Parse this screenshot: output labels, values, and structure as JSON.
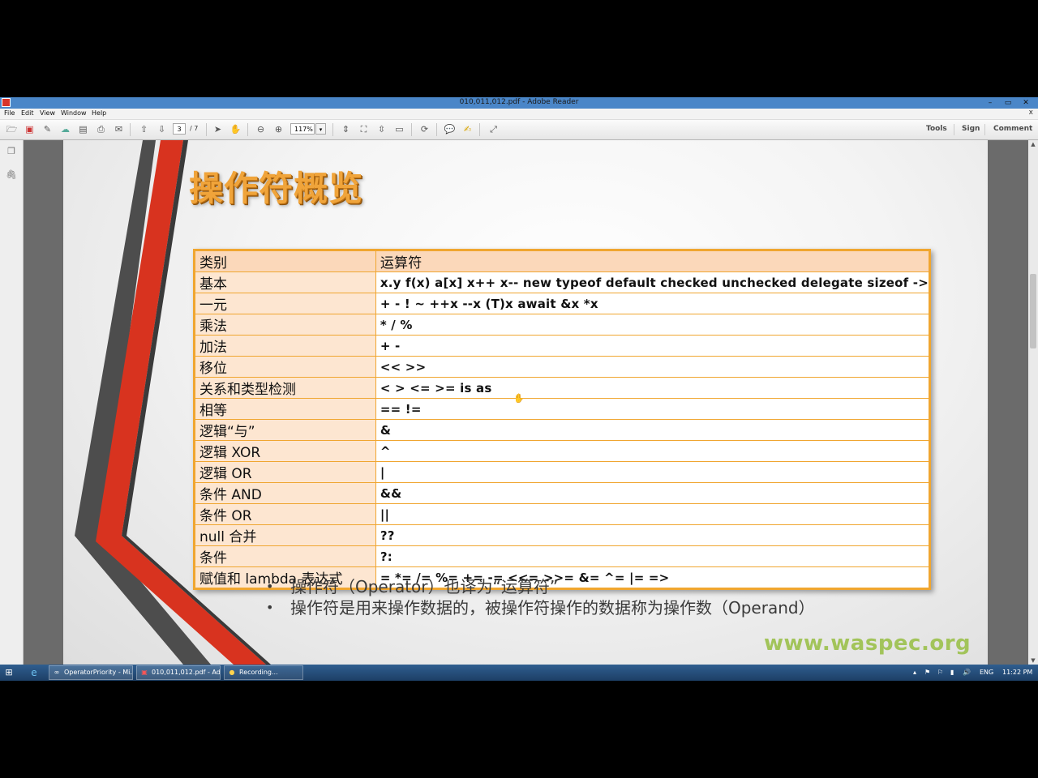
{
  "window": {
    "title": "010,011,012.pdf - Adobe Reader",
    "min": "–",
    "max": "▭",
    "close": "✕"
  },
  "menu": {
    "items": [
      "File",
      "Edit",
      "View",
      "Window",
      "Help"
    ],
    "close_doc": "x"
  },
  "toolbar": {
    "page_current": "3",
    "page_total": "/ 7",
    "zoom": "117%",
    "zoom_arrow": "▾",
    "tools_label": "Tools",
    "sign_label": "Sign",
    "comment_label": "Comment",
    "icons": [
      "open-icon",
      "create-pdf-icon",
      "edit-icon",
      "cloud-icon",
      "save-icon",
      "print-icon",
      "email-icon",
      "prev-page-icon",
      "next-page-icon",
      "select-tool-icon",
      "hand-tool-icon",
      "zoom-out-icon",
      "zoom-in-icon",
      "fit-page-icon",
      "fit-width-icon",
      "scrolling-mode-icon",
      "read-mode-icon",
      "share-icon",
      "comment-icon",
      "sign-icon",
      "fullscreen-icon"
    ]
  },
  "slide": {
    "title": "操作符概览",
    "table": {
      "header": {
        "category": "类别",
        "operators": "运算符"
      },
      "rows": [
        {
          "category": "基本",
          "operators": "x.y  f(x)  a[x]  x++  x--  new  typeof  default  checked  unchecked  delegate  sizeof  ->"
        },
        {
          "category": "一元",
          "operators": "+  -  !  ~  ++x  --x  (T)x  await  &x  *x"
        },
        {
          "category": "乘法",
          "operators": "*  /  %"
        },
        {
          "category": "加法",
          "operators": "+  -"
        },
        {
          "category": "移位",
          "operators": "<<  >>"
        },
        {
          "category": "关系和类型检测",
          "operators": "<  >  <=  >=  is  as"
        },
        {
          "category": "相等",
          "operators": "==  !="
        },
        {
          "category": "逻辑“与”",
          "operators": "&"
        },
        {
          "category": "逻辑 XOR",
          "operators": "^"
        },
        {
          "category": "逻辑 OR",
          "operators": "|"
        },
        {
          "category": "条件 AND",
          "operators": "&&"
        },
        {
          "category": "条件 OR",
          "operators": "||"
        },
        {
          "category": "null 合并",
          "operators": "??"
        },
        {
          "category": "条件",
          "operators": "?:"
        },
        {
          "category": "赋值和 lambda 表达式",
          "operators": "=  *=  /=  %=  +=  -=  <<=  >>=  &=  ^=  |=  =>"
        }
      ]
    },
    "bullets": [
      "操作符（Operator）也译为“运算符”",
      "操作符是用来操作数据的，被操作符操作的数据称为操作数（Operand）"
    ],
    "watermark": "www.waspec.org"
  },
  "taskbar": {
    "items": [
      {
        "label": "OperatorPriority - Mi...",
        "icon": "visual-studio-icon"
      },
      {
        "label": "010,011,012.pdf - Ad...",
        "icon": "adobe-reader-icon"
      },
      {
        "label": "Recording...",
        "icon": "recorder-icon"
      }
    ],
    "language": "ENG",
    "time": "11:22 PM"
  },
  "colors": {
    "title_orange": "#f0a43a",
    "table_border": "#f0a630",
    "category_fill": "#fde6d1",
    "watermark_green": "#a2c45a",
    "stripe_red": "#d8331f",
    "stripe_gray": "#4a4a4a"
  }
}
